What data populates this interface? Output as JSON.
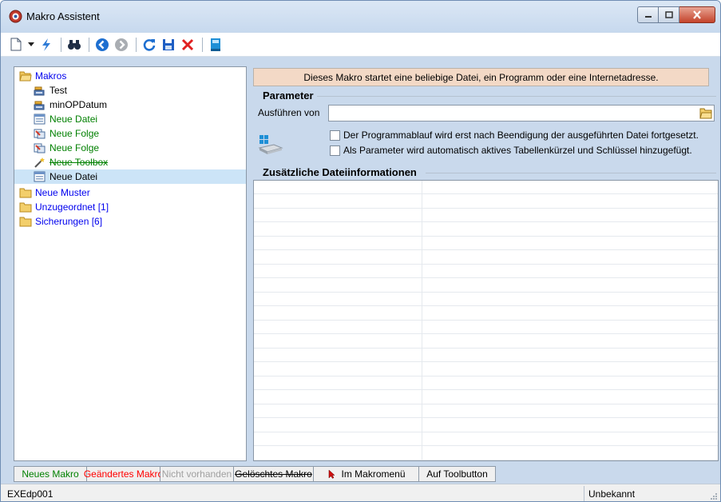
{
  "window": {
    "title": "Makro Assistent"
  },
  "toolbar": {
    "buttons": [
      "new-document-icon",
      "dropdown-arrow-icon",
      "lightning-icon",
      "binoculars-icon",
      "back-icon",
      "forward-icon",
      "refresh-icon",
      "save-icon",
      "delete-icon",
      "book-icon"
    ]
  },
  "tree": {
    "makros": "Makros",
    "items": [
      {
        "label": "Test",
        "icon": "database-icon",
        "color": "#000000",
        "strike": false
      },
      {
        "label": "minOPDatum",
        "icon": "database-icon",
        "color": "#000000",
        "strike": false
      },
      {
        "label": "Neue Datei",
        "icon": "form-icon",
        "color": "#008000",
        "strike": false
      },
      {
        "label": "Neue Folge",
        "icon": "sequence-icon",
        "color": "#008000",
        "strike": false
      },
      {
        "label": "Neue Folge",
        "icon": "sequence-icon",
        "color": "#008000",
        "strike": false
      },
      {
        "label": "Neue Toolbox",
        "icon": "wand-icon",
        "color": "#008000",
        "strike": true
      },
      {
        "label": "Neue Datei",
        "icon": "form-icon",
        "color": "#000000",
        "strike": false,
        "selected": true
      }
    ],
    "neue_muster": "Neue Muster",
    "unzugeordnet": "Unzugeordnet [1]",
    "sicherungen": "Sicherungen [6]"
  },
  "main": {
    "banner": "Dieses Makro startet eine beliebige Datei, ein Programm oder eine Internetadresse.",
    "parameter_title": "Parameter",
    "exec_label": "Ausführen von",
    "exec_value": "",
    "checkbox1": "Der Programmablauf wird erst nach Beendigung der ausgeführten Datei fortgesetzt.",
    "checkbox2": "Als Parameter wird automatisch aktives Tabellenkürzel und Schlüssel hinzugefügt.",
    "checkbox1_checked": false,
    "checkbox2_checked": false,
    "extra_title": "Zusätzliche Dateiinformationen"
  },
  "legend": {
    "items": [
      {
        "label": "Neues Makro",
        "color": "#008000"
      },
      {
        "label": "Geändertes Makro",
        "color": "#ff0000"
      },
      {
        "label": "Nicht vorhanden",
        "color": "#a0a0a0"
      },
      {
        "label": "Gelöschtes Makro",
        "color": "#000000"
      },
      {
        "label": "Im Makromenü",
        "color": "#000000"
      },
      {
        "label": "Auf Toolbutton",
        "color": "#000000"
      }
    ]
  },
  "status": {
    "left": "EXEdp001",
    "right": "Unbekannt"
  }
}
